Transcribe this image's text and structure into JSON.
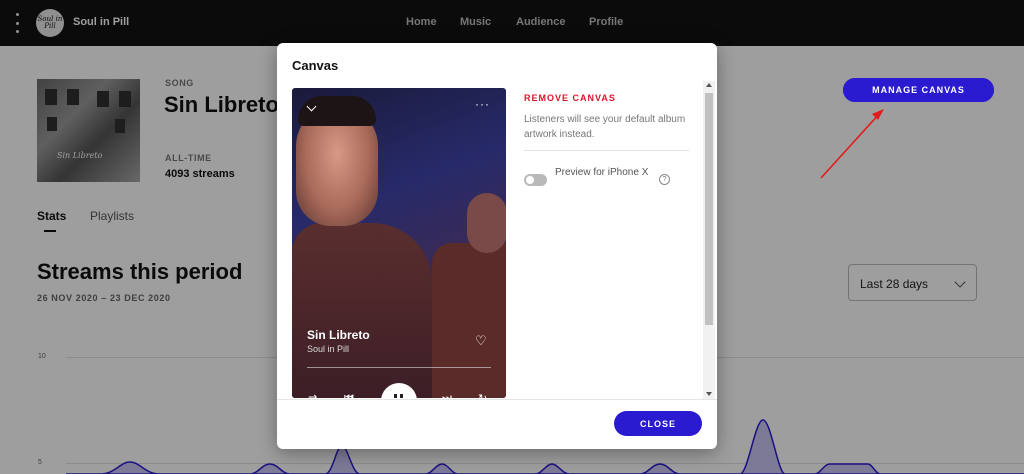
{
  "header": {
    "artist_name": "Soul in Pill",
    "logo_text": "Soul in Pill",
    "nav": [
      {
        "label": "Home"
      },
      {
        "label": "Music"
      },
      {
        "label": "Audience"
      },
      {
        "label": "Profile"
      }
    ]
  },
  "song": {
    "type_label": "SONG",
    "title": "Sin Libreto",
    "alltime_label": "ALL-TIME",
    "streams": "4093 streams",
    "album_script": "Sin Libreto",
    "manage_canvas": "MANAGE CANVAS"
  },
  "tabs": [
    {
      "label": "Stats",
      "active": true
    },
    {
      "label": "Playlists",
      "active": false
    }
  ],
  "period": {
    "title": "Streams this period",
    "dates": "26 NOV 2020 – 23 DEC 2020",
    "range": "Last 28 days"
  },
  "chart": {
    "y_ticks": [
      "10",
      "5"
    ],
    "accent": "#2a1bd1"
  },
  "modal": {
    "title": "Canvas",
    "preview": {
      "song": "Sin Libreto",
      "artist": "Soul in Pill",
      "more": "···"
    },
    "remove_label": "REMOVE CANVAS",
    "remove_desc": "Listeners will see your default album artwork instead.",
    "toggle_label": "Preview for iPhone X",
    "toggle_on": false,
    "help": "?",
    "close_label": "CLOSE"
  },
  "colors": {
    "topbar": "#121212",
    "primary_button": "#2a1bd1",
    "remove": "#e0142b"
  }
}
